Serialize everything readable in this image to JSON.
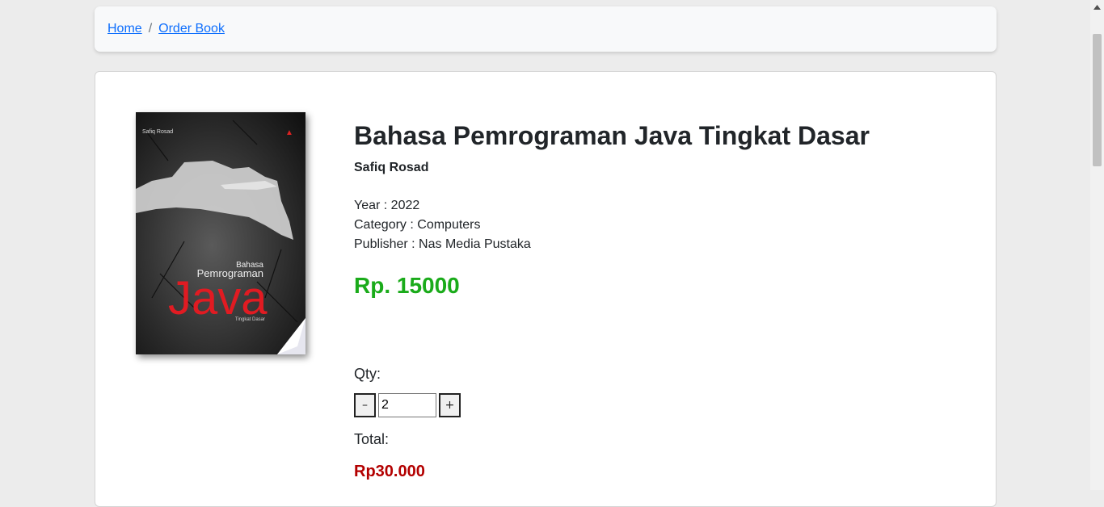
{
  "breadcrumb": {
    "items": [
      {
        "label": "Home"
      },
      {
        "label": "Order Book"
      }
    ],
    "separator": "/"
  },
  "book": {
    "cover": {
      "top_author": "Safiq Rosad",
      "line1": "Bahasa",
      "line2": "Pemrograman",
      "line3": "Java",
      "line4": "Tingkat Dasar"
    },
    "title": "Bahasa Pemrograman Java Tingkat Dasar",
    "author": "Safiq Rosad",
    "year": "Year : 2022",
    "category": "Category : Computers",
    "publisher": "Publisher : Nas Media Pustaka",
    "price": "Rp. 15000"
  },
  "order": {
    "qty_label": "Qty:",
    "minus_label": "–",
    "plus_label": "+",
    "qty_value": "2",
    "total_label": "Total:",
    "total_value": "Rp30.000"
  },
  "colors": {
    "price": "#1aab1a",
    "total": "#b30000",
    "link": "#0d6efd"
  }
}
